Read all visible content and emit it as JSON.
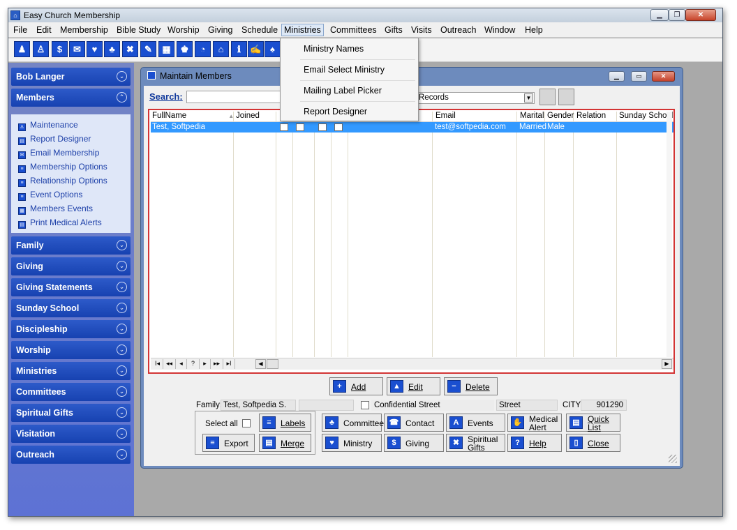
{
  "app": {
    "title": "Easy Church Membership"
  },
  "menubar": [
    "File",
    "Edit",
    "Membership",
    "Bible Study",
    "Worship",
    "Giving",
    "Schedule",
    "Ministries",
    "Committees",
    "Gifts",
    "Visits",
    "Outreach",
    "Window",
    "Help"
  ],
  "toolbar": {
    "icons": [
      "family-icon",
      "member-icon",
      "dollar-icon",
      "mail-icon",
      "heart-icon",
      "group-icon",
      "tools-icon",
      "pen-icon",
      "grid-icon",
      "people-icon",
      "calendar-clock-icon",
      "house-icon",
      "info-icon",
      "letter-icon",
      "tree-icon"
    ],
    "glyphs": [
      "♟",
      "♙",
      "$",
      "✉",
      "♥",
      "♣",
      "✖",
      "✎",
      "▦",
      "♚",
      "◔",
      "⌂",
      "ℹ",
      "✍",
      "♠"
    ]
  },
  "ministries_menu": [
    "Ministry Names",
    "Email Select Ministry",
    "Mailing Label Picker",
    "Report Designer"
  ],
  "sidebar": {
    "user": "Bob Langer",
    "members_header": "Members",
    "members_items": [
      "Maintenance",
      "Report Designer",
      "Email Membership",
      "Membership Options",
      "Relationship Options",
      "Event Options",
      "Members Events",
      "Print Medical Alerts"
    ],
    "sections": [
      "Family",
      "Giving",
      "Giving Statements",
      "Sunday School",
      "Discipleship",
      "Worship",
      "Ministries",
      "Committees",
      "Spiritual Gifts",
      "Visitation",
      "Outreach"
    ]
  },
  "maintain": {
    "title": "Maintain Members",
    "search_label": "Search",
    "search_colon": ":",
    "records_value": "Records",
    "columns": [
      "FullName",
      "Joined",
      "Email",
      "Marital",
      "Gender",
      "Relation",
      "Sunday School"
    ],
    "row": {
      "fullname": "Test, Softpedia",
      "email": "test@softpedia.com",
      "marital": "Married",
      "gender": "Male"
    },
    "nav_buttons": [
      "I◂",
      "◂◂",
      "◂",
      "?",
      "▸",
      "▸▸",
      "▸I"
    ],
    "add": "Add",
    "edit": "Edit",
    "delete": "Delete",
    "family_label": "Family:",
    "family_value": "Test, Softpedia S.",
    "confidential_street": "Confidential Street",
    "street": "Street",
    "city": "CITY",
    "zip": "901290",
    "select_all": "Select all",
    "buttons": {
      "labels": "Labels",
      "export": "Export",
      "merge": "Merge",
      "committee": "Committee",
      "contact": "Contact",
      "events": "Events",
      "medical_alert": "Medical Alert",
      "quick_list": "Quick List",
      "ministry": "Ministry",
      "giving": "Giving",
      "spiritual_gifts": "Spiritual Gifts",
      "help": "Help",
      "close": "Close"
    }
  },
  "colors": {
    "sidebar_header": "#1f4bbd",
    "selection": "#3399ff",
    "grid_border": "#d33434"
  }
}
